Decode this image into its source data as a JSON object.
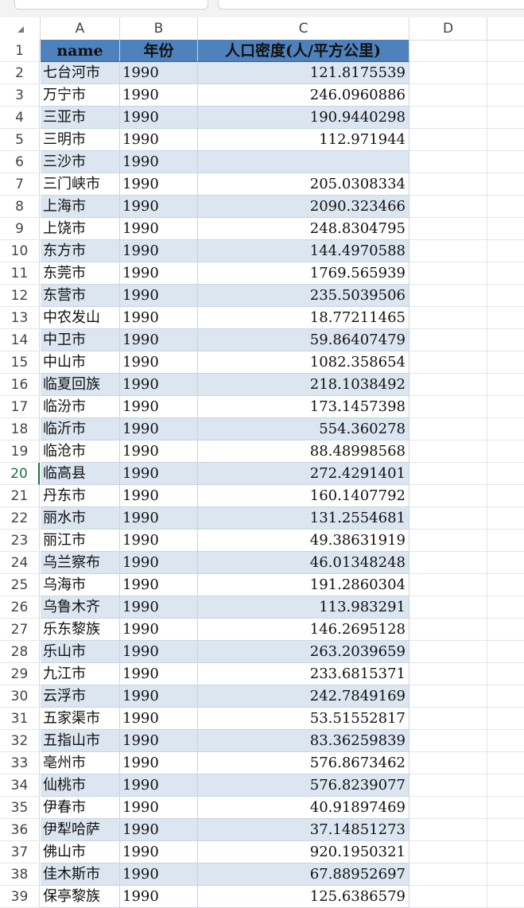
{
  "columns": [
    "A",
    "B",
    "C",
    "D"
  ],
  "header": {
    "row": "1",
    "name": "name",
    "year": "年份",
    "density": "人口密度(人/平方公里)"
  },
  "active_row": "20",
  "rows": [
    {
      "n": "2",
      "name": "七台河市",
      "year": "1990",
      "density": "121.8175539"
    },
    {
      "n": "3",
      "name": "万宁市",
      "year": "1990",
      "density": "246.0960886"
    },
    {
      "n": "4",
      "name": "三亚市",
      "year": "1990",
      "density": "190.9440298"
    },
    {
      "n": "5",
      "name": "三明市",
      "year": "1990",
      "density": "112.971944"
    },
    {
      "n": "6",
      "name": "三沙市",
      "year": "1990",
      "density": ""
    },
    {
      "n": "7",
      "name": "三门峡市",
      "year": "1990",
      "density": "205.0308334"
    },
    {
      "n": "8",
      "name": "上海市",
      "year": "1990",
      "density": "2090.323466"
    },
    {
      "n": "9",
      "name": "上饶市",
      "year": "1990",
      "density": "248.8304795"
    },
    {
      "n": "10",
      "name": "东方市",
      "year": "1990",
      "density": "144.4970588"
    },
    {
      "n": "11",
      "name": "东莞市",
      "year": "1990",
      "density": "1769.565939"
    },
    {
      "n": "12",
      "name": "东营市",
      "year": "1990",
      "density": "235.5039506"
    },
    {
      "n": "13",
      "name": "中农发山",
      "year": "1990",
      "density": "18.77211465"
    },
    {
      "n": "14",
      "name": "中卫市",
      "year": "1990",
      "density": "59.86407479"
    },
    {
      "n": "15",
      "name": "中山市",
      "year": "1990",
      "density": "1082.358654"
    },
    {
      "n": "16",
      "name": "临夏回族",
      "year": "1990",
      "density": "218.1038492"
    },
    {
      "n": "17",
      "name": "临汾市",
      "year": "1990",
      "density": "173.1457398"
    },
    {
      "n": "18",
      "name": "临沂市",
      "year": "1990",
      "density": "554.360278"
    },
    {
      "n": "19",
      "name": "临沧市",
      "year": "1990",
      "density": "88.48998568"
    },
    {
      "n": "20",
      "name": "临高县",
      "year": "1990",
      "density": "272.4291401"
    },
    {
      "n": "21",
      "name": "丹东市",
      "year": "1990",
      "density": "160.1407792"
    },
    {
      "n": "22",
      "name": "丽水市",
      "year": "1990",
      "density": "131.2554681"
    },
    {
      "n": "23",
      "name": "丽江市",
      "year": "1990",
      "density": "49.38631919"
    },
    {
      "n": "24",
      "name": "乌兰察布",
      "year": "1990",
      "density": "46.01348248"
    },
    {
      "n": "25",
      "name": "乌海市",
      "year": "1990",
      "density": "191.2860304"
    },
    {
      "n": "26",
      "name": "乌鲁木齐",
      "year": "1990",
      "density": "113.983291"
    },
    {
      "n": "27",
      "name": "乐东黎族",
      "year": "1990",
      "density": "146.2695128"
    },
    {
      "n": "28",
      "name": "乐山市",
      "year": "1990",
      "density": "263.2039659"
    },
    {
      "n": "29",
      "name": "九江市",
      "year": "1990",
      "density": "233.6815371"
    },
    {
      "n": "30",
      "name": "云浮市",
      "year": "1990",
      "density": "242.7849169"
    },
    {
      "n": "31",
      "name": "五家渠市",
      "year": "1990",
      "density": "53.51552817"
    },
    {
      "n": "32",
      "name": "五指山市",
      "year": "1990",
      "density": "83.36259839"
    },
    {
      "n": "33",
      "name": "亳州市",
      "year": "1990",
      "density": "576.8673462"
    },
    {
      "n": "34",
      "name": "仙桃市",
      "year": "1990",
      "density": "576.8239077"
    },
    {
      "n": "35",
      "name": "伊春市",
      "year": "1990",
      "density": "40.91897469"
    },
    {
      "n": "36",
      "name": "伊犁哈萨",
      "year": "1990",
      "density": "37.14851273"
    },
    {
      "n": "37",
      "name": "佛山市",
      "year": "1990",
      "density": "920.1950321"
    },
    {
      "n": "38",
      "name": "佳木斯市",
      "year": "1990",
      "density": "67.88952697"
    },
    {
      "n": "39",
      "name": "保亭黎族",
      "year": "1990",
      "density": "125.6386579"
    }
  ]
}
